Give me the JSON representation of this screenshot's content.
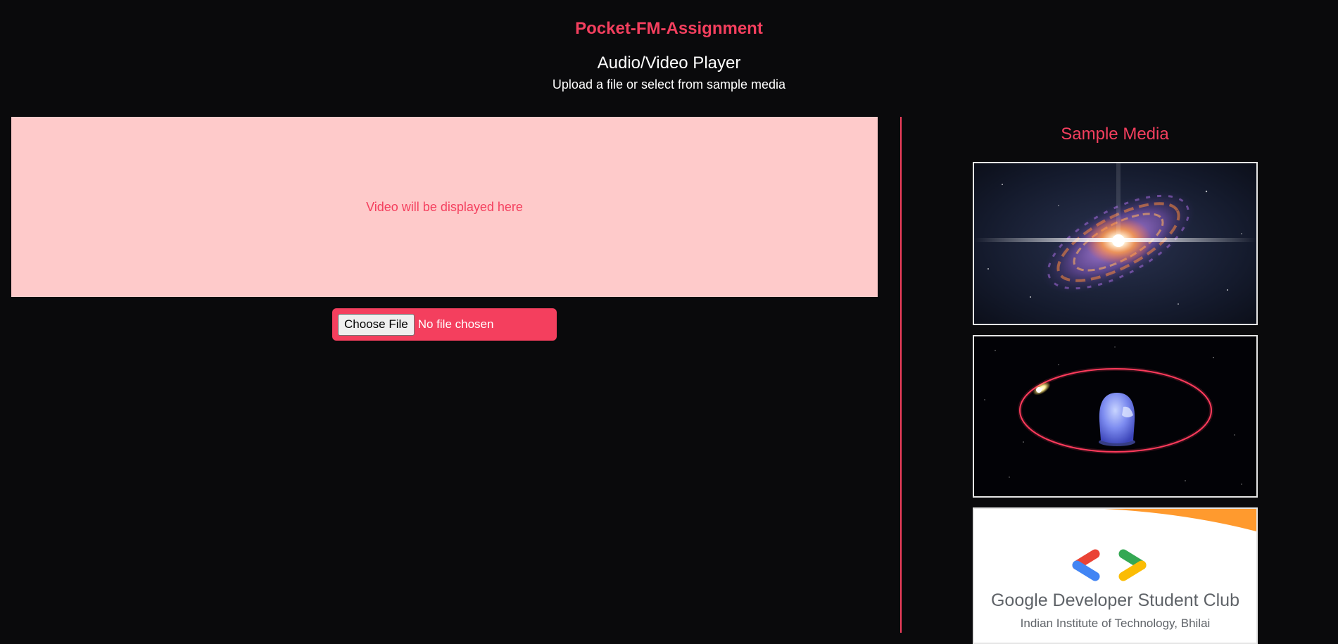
{
  "header": {
    "app_title": "Pocket-FM-Assignment",
    "page_title": "Audio/Video Player",
    "subtitle": "Upload a file or select from sample media"
  },
  "player": {
    "placeholder": "Video will be displayed here"
  },
  "file_input": {
    "button_label": "Choose File",
    "status": "No file chosen"
  },
  "sidebar": {
    "title": "Sample Media",
    "items": [
      {
        "kind": "video-thumbnail",
        "subject": "galaxy"
      },
      {
        "kind": "video-thumbnail",
        "subject": "orbiting-helmet"
      },
      {
        "kind": "image-thumbnail",
        "subject": "gdsc-logo",
        "name": "Google Developer Student Club",
        "org": "Indian Institute of Technology, Bhilai"
      }
    ]
  },
  "colors": {
    "background": "#0a0a0c",
    "accent": "#f43f5e",
    "player_bg": "#fecaca",
    "text": "#ffffff"
  }
}
